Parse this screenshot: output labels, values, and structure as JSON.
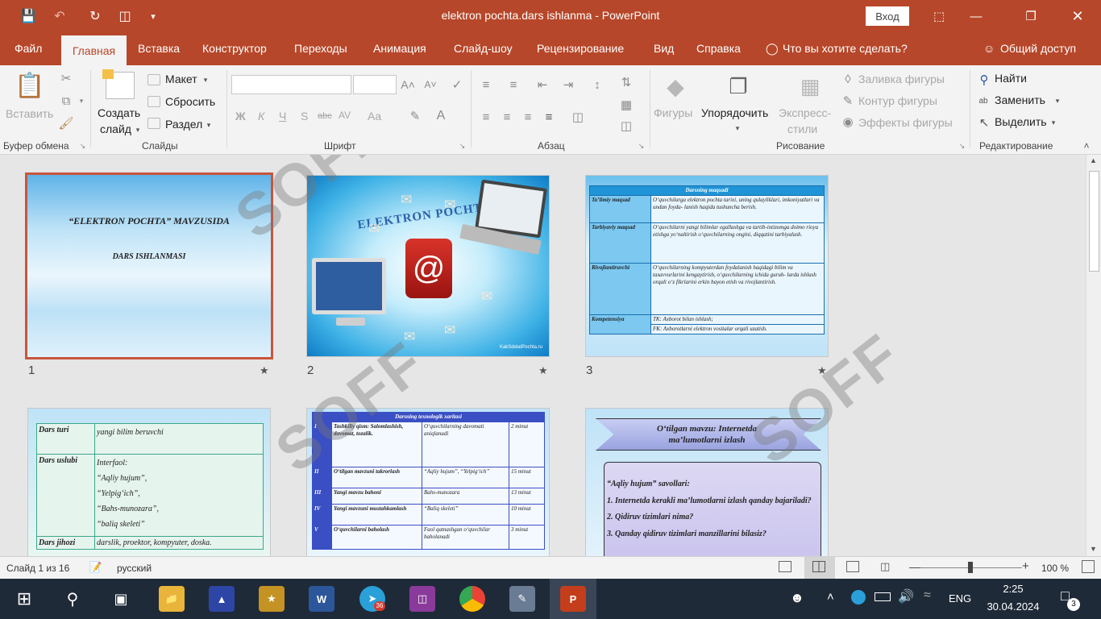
{
  "titlebar": {
    "document_title": "elektron pochta.dars ishlanma  -  PowerPoint",
    "signin_label": "Вход"
  },
  "tabs": [
    "Файл",
    "Главная",
    "Вставка",
    "Конструктор",
    "Переходы",
    "Анимация",
    "Слайд-шоу",
    "Рецензирование",
    "Вид",
    "Справка"
  ],
  "active_tab": "Главная",
  "tellme": "Что вы хотите сделать?",
  "share": "Общий доступ",
  "ribbon": {
    "clipboard": {
      "label": "Буфер обмена",
      "paste": "Вставить"
    },
    "slides": {
      "label": "Слайды",
      "new_slide_line1": "Создать",
      "new_slide_line2": "слайд",
      "layout": "Макет",
      "reset": "Сбросить",
      "section": "Раздел"
    },
    "font": {
      "label": "Шрифт",
      "bold": "Ж",
      "italic": "К",
      "underline": "Ч",
      "strike": "S",
      "abc": "abc",
      "spacing": "AV",
      "case": "Aa"
    },
    "paragraph": {
      "label": "Абзац"
    },
    "drawing": {
      "label": "Рисование",
      "shapes": "Фигуры",
      "arrange": "Упорядочить",
      "quick_styles_line1": "Экспресс-",
      "quick_styles_line2": "стили",
      "fill": "Заливка фигуры",
      "outline": "Контур фигуры",
      "effects": "Эффекты фигуры"
    },
    "editing": {
      "label": "Редактирование",
      "find": "Найти",
      "replace": "Заменить",
      "select": "Выделить"
    }
  },
  "slides": [
    {
      "number": "1",
      "title": "“ELEKTRON POCHTA” MAVZUSIDA",
      "subtitle": "DARS ISHLANMASI"
    },
    {
      "number": "2",
      "title": "ELEKTRON POCHTA",
      "footer": "KakSdelatPochta.ru"
    },
    {
      "number": "3",
      "table_title": "Darsning maqsadi",
      "rows": [
        {
          "k": "Ta’limiy maqsad",
          "v": "O‘quvchilarga elektron pochta tarixi, uning qulayliklari, imkoniyatlari va undan foyda- lanish haqida tushuncha berish."
        },
        {
          "k": "Tarbiyaviy maqsad",
          "v": "O‘quvchilarni yangi bilimlar egallashga va tartib-intizomga doimo rioya etishga yo‘naltirish o‘quvchilarning ongini, diqqatini tarbiyalash."
        },
        {
          "k": "Rivojlantiruvchi",
          "v": "O‘quvchilarning kompyuterdan foydalanish haqidagi bilim va tasavvurlarini kengaytirish, o‘quvchilarning ichida guruh- larda ishlash orqali o‘z fikrlarini erkin bayon etish va rivojlantirish."
        },
        {
          "k": "Kompetensiya",
          "v": "TK: Axborot bilan ishlash;"
        },
        {
          "k": "",
          "v": "FK: Axborotlarni elektron vositalar orqali uzatish."
        }
      ]
    },
    {
      "number": "4",
      "rows": [
        {
          "k": "Dars turi",
          "v": [
            "yangi bilim beruvchi"
          ]
        },
        {
          "k": "Dars uslubi",
          "v": [
            "Interfaol:",
            "“Aqliy hujum”,",
            "“Yelpig‘ich”,",
            "“Bahs-munozara”,",
            "“baliq skeleti”"
          ]
        },
        {
          "k": "Dars jihozi",
          "v": [
            "darslik, proektor, kompyuter, doska."
          ]
        }
      ]
    },
    {
      "number": "5",
      "table_title": "Darsning texnologik xaritasi",
      "rows": [
        {
          "n": "I",
          "a": "Tashkiliy qism: Salomlashish, davomat, tozalik.",
          "b": "O‘quvchilarning davomati aniqlanadi",
          "c": "2 minut"
        },
        {
          "n": "II",
          "a": "O‘tilgan mavzuni takrorlash",
          "b": "“Aqliy hujum”, “Yelpig‘ich”",
          "c": "15 minut"
        },
        {
          "n": "III",
          "a": "Yangi mavzu bahoni",
          "b": "Bahs-munozara",
          "c": "13 minut"
        },
        {
          "n": "IV",
          "a": "Yangi mavzuni mustahkamlash",
          "b": "“Baliq skeleti”",
          "c": "10 minut"
        },
        {
          "n": "V",
          "a": "O‘quvchilarni baholash",
          "b": "Faol qatnashgan o‘quvchilar baholanadi",
          "c": "3 minut"
        }
      ]
    },
    {
      "number": "6",
      "banner": "O‘tilgan mavzu: Internetda ma’lumotlarni izlash",
      "heading": "“Aqliy hujum” savollari:",
      "questions": [
        "1. Internetda kerakli ma’lumotlarni izlash qanday bajariladi?",
        "2. Qidiruv tizimlari nima?",
        "3. Qanday qidiruv tizimlari manzillarini bilasiz?"
      ]
    }
  ],
  "status": {
    "slide_counter": "Слайд 1 из 16",
    "language": "русский",
    "zoom": "100 %"
  },
  "taskbar": {
    "time": "2:25",
    "date": "30.04.2024",
    "lang": "ENG",
    "notifications": "3",
    "telegram_badge": "36"
  },
  "watermark": "SOFF",
  "colors": {
    "accent": "#b7472a",
    "taskbar": "#1f2a38"
  }
}
